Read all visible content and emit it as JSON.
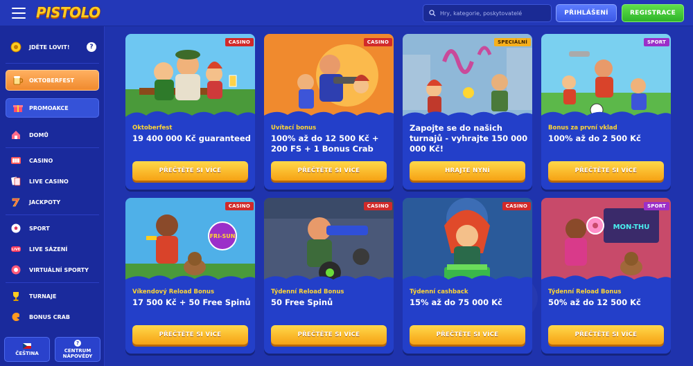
{
  "header": {
    "logo": "PISTOLO",
    "search_placeholder": "Hry, kategorie, poskytovatelé",
    "login_label": "PŘIHLÁŠENÍ",
    "register_label": "REGISTRACE"
  },
  "sidebar": {
    "hunt_label": "JDĚTE LOVIT!",
    "hunt_help": "?",
    "oktoberfest_label": "OKTOBERFEST",
    "promo_label": "PROMOAKCE",
    "items": [
      {
        "label": "DOMŮ",
        "icon": "home-icon"
      },
      {
        "label": "CASINO",
        "icon": "slot-machine-icon"
      },
      {
        "label": "LIVE CASINO",
        "icon": "cards-icon"
      },
      {
        "label": "JACKPOTY",
        "icon": "seven-icon"
      },
      {
        "label": "SPORT",
        "icon": "football-icon"
      },
      {
        "label": "LIVE SÁZENÍ",
        "icon": "live-icon"
      },
      {
        "label": "VIRTUÁLNÍ SPORTY",
        "icon": "virtual-sports-icon"
      },
      {
        "label": "TURNAJE",
        "icon": "trophy-icon"
      },
      {
        "label": "BONUS CRAB",
        "icon": "crab-claw-icon"
      }
    ],
    "language_label": "ČEŠTINA",
    "help_label_1": "CENTRUM",
    "help_label_2": "NÁPOVĚDY"
  },
  "cards": [
    {
      "badge": "CASINO",
      "subtitle": "Oktoberfest",
      "headline": "19 400 000 Kč guaranteed",
      "cta": "PŘEČTĚTE SI VÍCE"
    },
    {
      "badge": "CASINO",
      "subtitle": "Uvítací bonus",
      "headline": "100% až do 12 500 Kč + 200 FS + 1 Bonus Crab",
      "cta": "PŘEČTĚTE SI VÍCE"
    },
    {
      "badge": "SPECIÁLNÍ",
      "subtitle": "",
      "headline": "Zapojte se do našich turnajů - vyhrajte 150 000 000 Kč!",
      "cta": "HRAJTE NYNÍ"
    },
    {
      "badge": "SPORT",
      "subtitle": "Bonus za první vklad",
      "headline": "100% až do 2 500 Kč",
      "cta": "PŘEČTĚTE SI VÍCE"
    },
    {
      "badge": "CASINO",
      "subtitle": "Víkendový Reload Bonus",
      "headline": "17 500 Kč + 50 Free Spinů",
      "cta": "PŘEČTĚTE SI VÍCE"
    },
    {
      "badge": "CASINO",
      "subtitle": "Týdenní Reload Bonus",
      "headline": "50 Free Spinů",
      "cta": "PŘEČTĚTE SI VÍCE"
    },
    {
      "badge": "CASINO",
      "subtitle": "Týdenní cashback",
      "headline": "15% až do 75 000 Kč",
      "cta": "PŘEČTĚTE SI VÍCE"
    },
    {
      "badge": "SPORT",
      "subtitle": "Týdenní Reload Bonus",
      "headline": "50% až do 12 500 Kč",
      "cta": "PŘEČTĚTE SI VÍCE"
    }
  ],
  "art_signs": {
    "fri_sun": "FRI-SUN",
    "mon_thu": "MON-THU"
  },
  "colors": {
    "brand_blue": "#1d2fa8",
    "cta_yellow": "#f6a214",
    "register_green": "#2fb42a",
    "casino_badge": "#d12a2a",
    "sport_badge": "#9b2fc9",
    "special_badge": "#f7b01c"
  }
}
